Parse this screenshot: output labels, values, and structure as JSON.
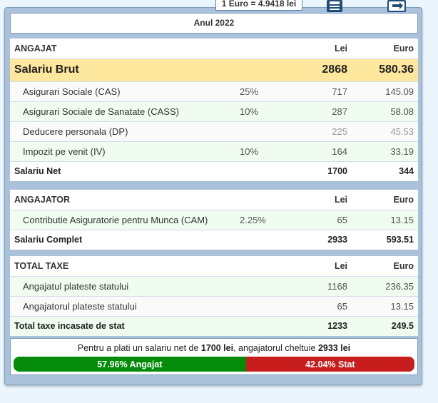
{
  "exchange_rate": "1 Euro = 4.9418 lei",
  "toolbar": {
    "print_icon": "printer-icon",
    "export_icon": "export-icon"
  },
  "year_label": "Anul 2022",
  "angajat": {
    "heading": "ANGAJAT",
    "col_lei": "Lei",
    "col_euro": "Euro",
    "brut": {
      "label": "Salariu Brut",
      "lei": "2868",
      "euro": "580.36"
    },
    "items": [
      {
        "label": "Asigurari Sociale (CAS)",
        "pct": "25%",
        "lei": "717",
        "euro": "145.09"
      },
      {
        "label": "Asigurari Sociale de Sanatate (CASS)",
        "pct": "10%",
        "lei": "287",
        "euro": "58.08"
      },
      {
        "label": "Deducere personala (DP)",
        "pct": "",
        "lei": "225",
        "euro": "45.53"
      },
      {
        "label": "Impozit pe venit (IV)",
        "pct": "10%",
        "lei": "164",
        "euro": "33.19"
      }
    ],
    "net": {
      "label": "Salariu Net",
      "lei": "1700",
      "euro": "344"
    }
  },
  "angajator": {
    "heading": "ANGAJATOR",
    "col_lei": "Lei",
    "col_euro": "Euro",
    "items": [
      {
        "label": "Contributie Asiguratorie pentru Munca (CAM)",
        "pct": "2.25%",
        "lei": "65",
        "euro": "13.15"
      }
    ],
    "total": {
      "label": "Salariu Complet",
      "lei": "2933",
      "euro": "593.51"
    }
  },
  "taxe": {
    "heading": "TOTAL TAXE",
    "col_lei": "Lei",
    "col_euro": "Euro",
    "items": [
      {
        "label": "Angajatul plateste statului",
        "lei": "1168",
        "euro": "236.35"
      },
      {
        "label": "Angajatorul plateste statului",
        "lei": "65",
        "euro": "13.15"
      }
    ],
    "total": {
      "label": "Total taxe incasate de stat",
      "lei": "1233",
      "euro": "249.5"
    }
  },
  "summary": {
    "prefix": "Pentru a plati un salariu net de ",
    "net": "1700 lei",
    "middle": ", angajatorul cheltuie ",
    "cost": "2933 lei",
    "angajat_label": "57.96% Angajat",
    "stat_label": "42.04% Stat",
    "angajat_fraction": 0.5796,
    "colors": {
      "angajat": "#048b0a",
      "stat": "#c81d1d",
      "highlight": "#fde79c"
    }
  }
}
